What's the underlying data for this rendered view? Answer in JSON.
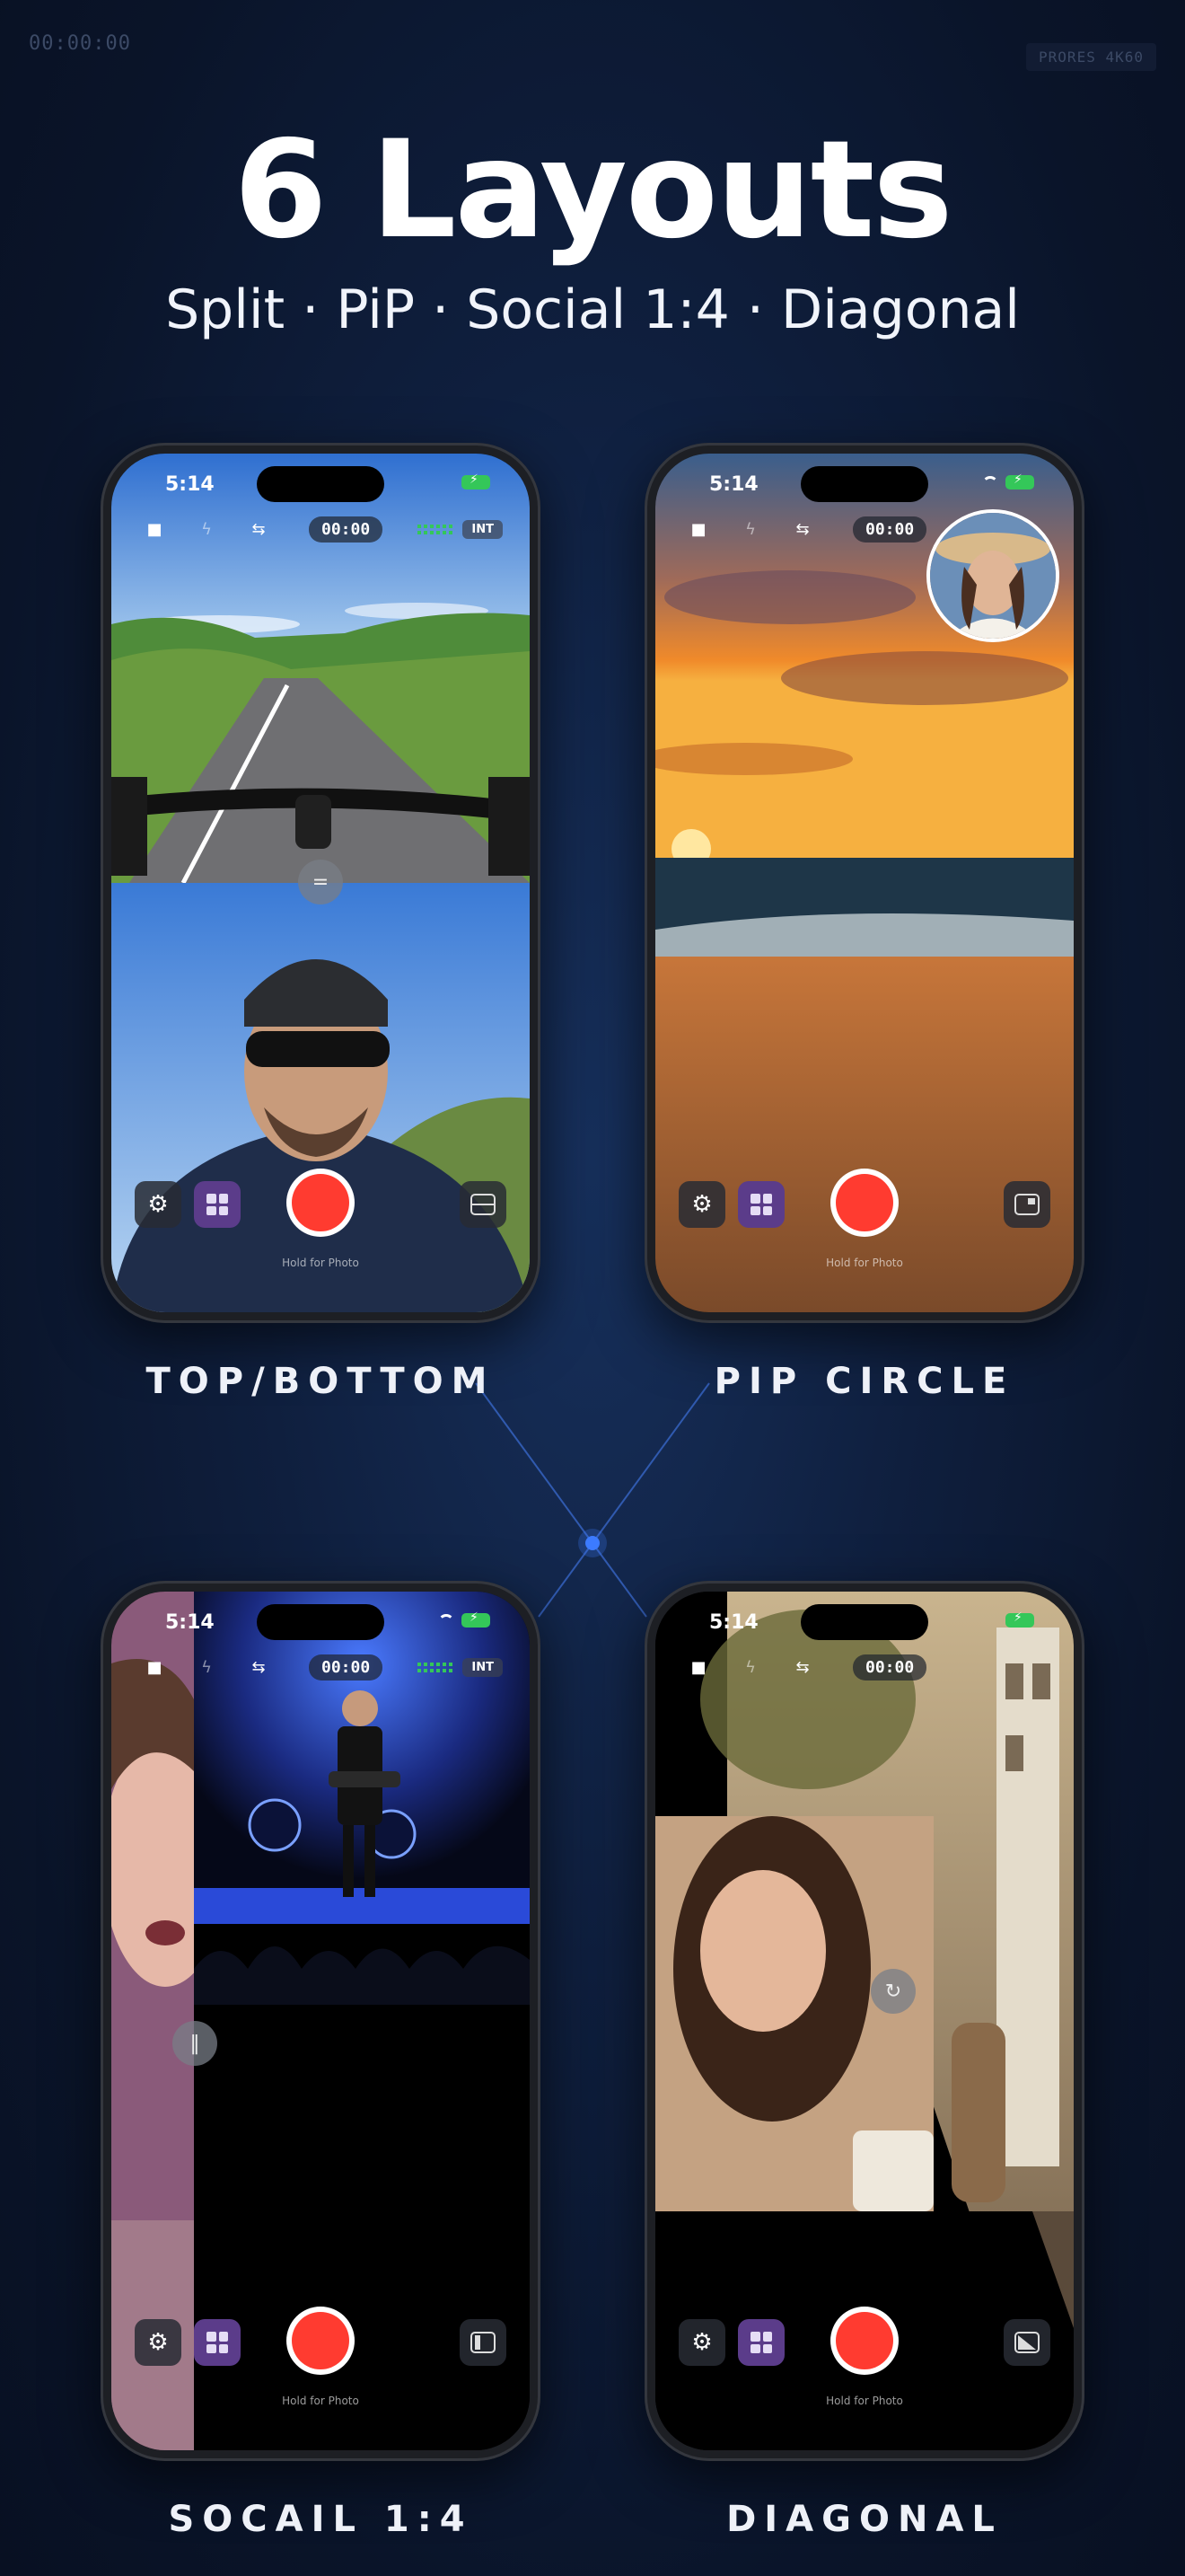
{
  "header": {
    "timecode": "00:00:00",
    "format_badge": "PRORES 4K60",
    "title": "6 Layouts",
    "subtitle": "Split · PiP · Social 1:4 · Diagonal"
  },
  "phones": [
    {
      "status_time": "5:14",
      "timer": "00:00",
      "input": "INT",
      "hold_hint": "Hold for Photo",
      "label": "TOP/BOTTOM"
    },
    {
      "status_time": "5:14",
      "timer": "00:00",
      "input": "",
      "hold_hint": "Hold for Photo",
      "label": "PIP CIRCLE"
    },
    {
      "status_time": "5:14",
      "timer": "00:00",
      "input": "INT",
      "hold_hint": "Hold for Photo",
      "label": "SOCAIL 1:4"
    },
    {
      "status_time": "5:14",
      "timer": "00:00",
      "input": "",
      "hold_hint": "Hold for Photo",
      "label": "DIAGONAL"
    }
  ],
  "icons": {
    "camera": "video-camera-icon",
    "flash": "flash-off-icon",
    "swap": "swap-camera-icon",
    "settings": "gear-icon",
    "layouts": "layout-grid-icon",
    "record": "record-button",
    "mode": "layout-mode-icon"
  },
  "colors": {
    "background": "#0f1f3e",
    "accent": "#3d7bff",
    "record": "#ff3b30",
    "layout_button": "#5b3c8a",
    "meter": "#34c759"
  }
}
